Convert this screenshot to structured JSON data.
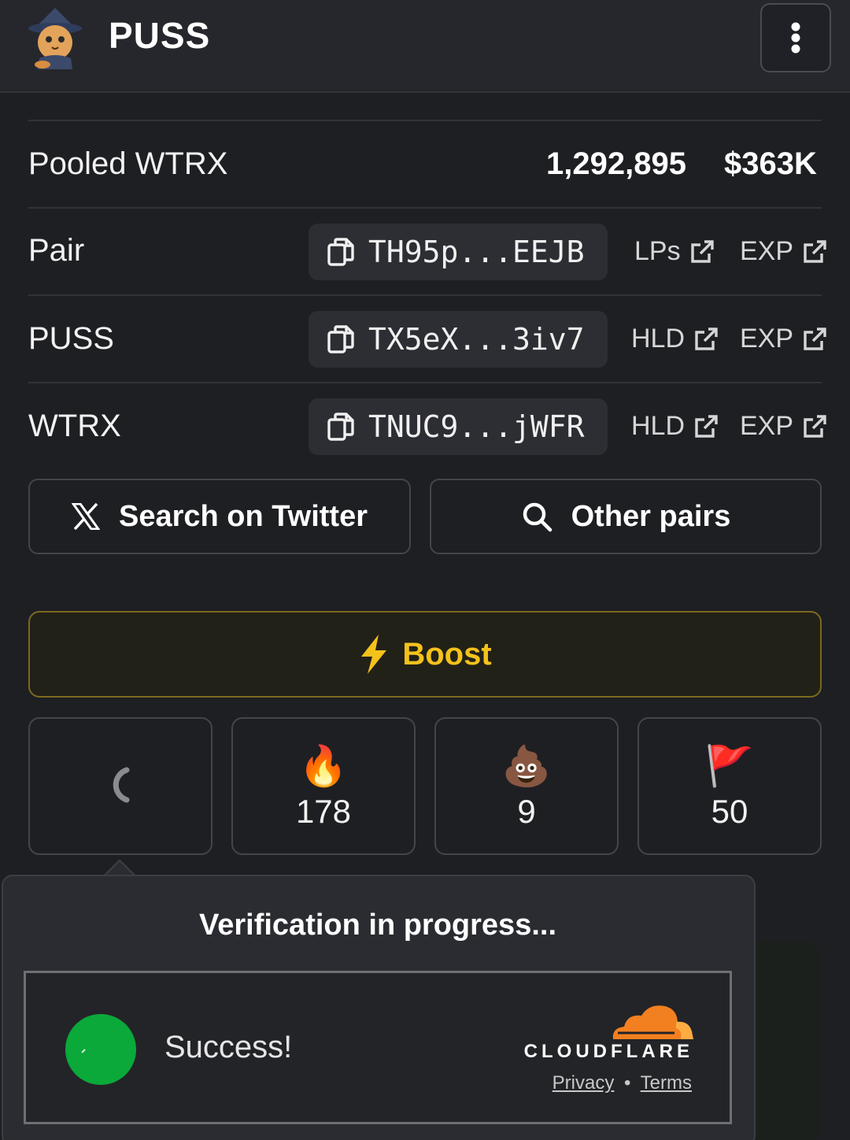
{
  "header": {
    "title": "PUSS"
  },
  "pooled": {
    "label": "Pooled WTRX",
    "amount": "1,292,895",
    "usd": "$363K"
  },
  "rows": [
    {
      "label": "Pair",
      "address": "TH95p...EEJB",
      "link1": "LPs",
      "link2": "EXP"
    },
    {
      "label": "PUSS",
      "address": "TX5eX...3iv7",
      "link1": "HLD",
      "link2": "EXP"
    },
    {
      "label": "WTRX",
      "address": "TNUC9...jWFR",
      "link1": "HLD",
      "link2": "EXP"
    }
  ],
  "buttons": {
    "twitter": "Search on Twitter",
    "other_pairs": "Other pairs",
    "boost": "Boost"
  },
  "reactions": [
    {
      "icon": "loading-spinner",
      "count": ""
    },
    {
      "icon": "fire",
      "emoji": "🔥",
      "count": "178"
    },
    {
      "icon": "poop",
      "emoji": "💩",
      "count": "9"
    },
    {
      "icon": "red-flag",
      "emoji": "🚩",
      "count": "50"
    }
  ],
  "verification": {
    "title": "Verification in progress...",
    "status": "Success!",
    "brand": "CLOUDFLARE",
    "privacy": "Privacy",
    "separator": "•",
    "terms": "Terms"
  },
  "colors": {
    "accent": "#f4c21b",
    "success": "#0aa93a",
    "cloudflare": "#f38020"
  }
}
